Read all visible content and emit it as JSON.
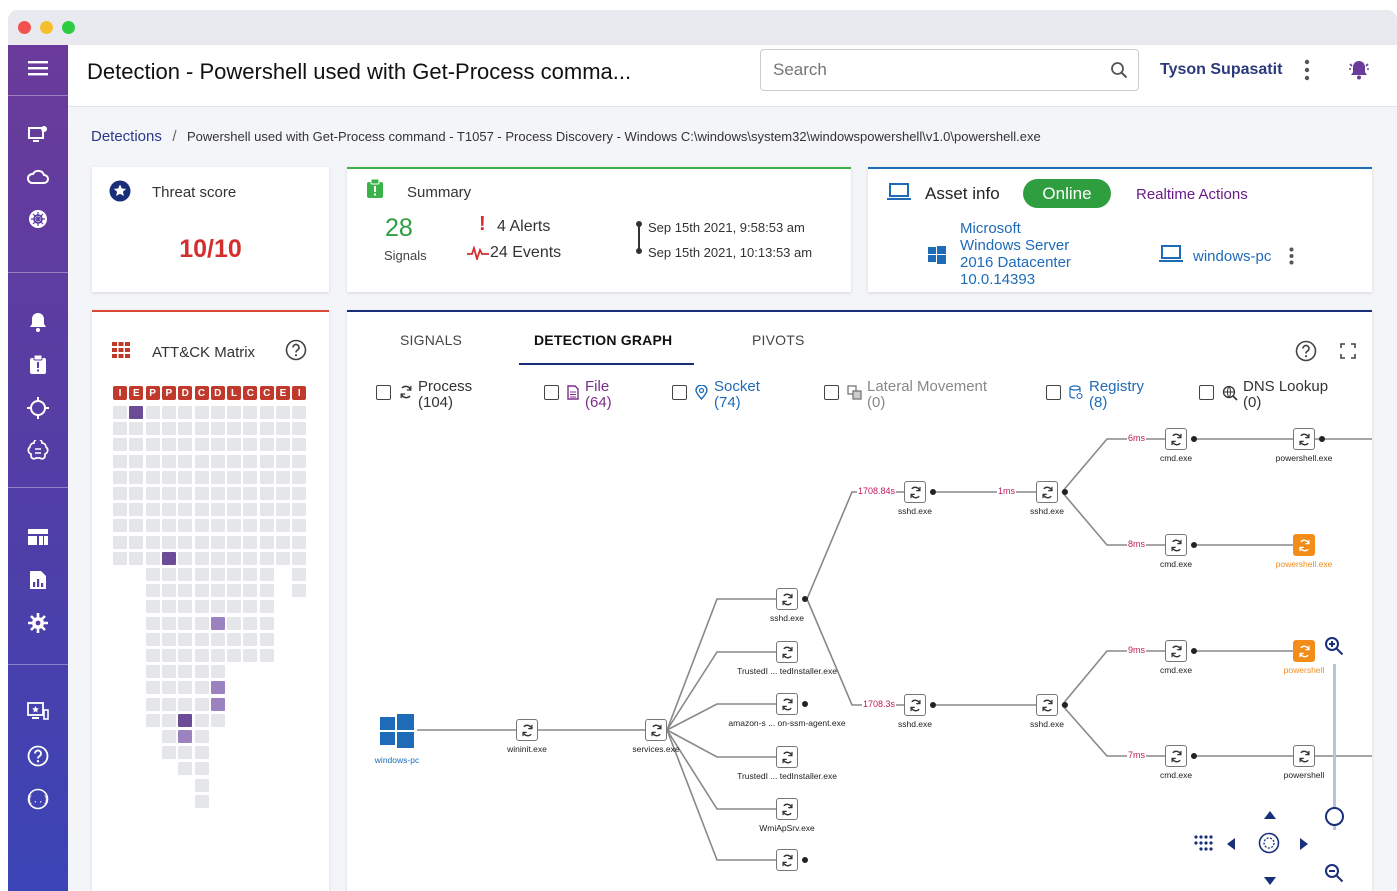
{
  "window": {
    "controls": [
      "close",
      "minimize",
      "maximize"
    ]
  },
  "header": {
    "title": "Detection - Powershell used with Get-Process comma...",
    "search_placeholder": "Search",
    "user": "Tyson Supasatit"
  },
  "breadcrumb": {
    "root": "Detections",
    "separator": "/",
    "current": "Powershell used with Get-Process command - T1057 - Process Discovery - Windows C:\\windows\\system32\\windowspowershell\\v1.0\\powershell.exe"
  },
  "threat": {
    "label": "Threat score",
    "value": "10/10"
  },
  "summary": {
    "label": "Summary",
    "signals_count": "28",
    "signals_label": "Signals",
    "alerts": "4 Alerts",
    "events": "24 Events",
    "time_start": "Sep 15th 2021, 9:58:53 am",
    "time_end": "Sep 15th 2021, 10:13:53 am"
  },
  "asset": {
    "label": "Asset info",
    "status": "Online",
    "realtime": "Realtime Actions",
    "os_line1": "Microsoft",
    "os_line2": "Windows Server",
    "os_line3": "2016 Datacenter",
    "os_version": "10.0.14393",
    "host": "windows-pc"
  },
  "matrix": {
    "label": "ATT&CK Matrix",
    "columns": [
      "I",
      "E",
      "P",
      "P",
      "D",
      "C",
      "D",
      "L",
      "C",
      "C",
      "E",
      "I"
    ],
    "column_heights": [
      13,
      13,
      20,
      22,
      23,
      25,
      20,
      16,
      16,
      16,
      14,
      12
    ],
    "selected_count": 4,
    "shaded_count": 5
  },
  "tabs": [
    {
      "label": "SIGNALS",
      "active": false
    },
    {
      "label": "DETECTION GRAPH",
      "active": true
    },
    {
      "label": "PIVOTS",
      "active": false
    }
  ],
  "filters": [
    {
      "label": "Process",
      "count": "(104)",
      "color": "#333333"
    },
    {
      "label": "File",
      "count": "(64)",
      "color": "#7b2d8b"
    },
    {
      "label": "Socket",
      "count": "(74)",
      "color": "#1e6bb8"
    },
    {
      "label": "Lateral Movement",
      "count": "(0)",
      "color": "#888888"
    },
    {
      "label": "Registry",
      "count": "(8)",
      "color": "#1e6bb8"
    },
    {
      "label": "DNS Lookup",
      "count": "(0)",
      "color": "#333333"
    }
  ],
  "graph": {
    "host_label": "windows-pc",
    "nodes": [
      "wininit.exe",
      "services.exe",
      "sshd.exe",
      "TrustedI ... tedInstaller.exe",
      "amazon-s ... on-ssm-agent.exe",
      "TrustedI ... tedInstaller.exe",
      "WmiApSrv.exe",
      "sshd.exe",
      "sshd.exe",
      "sshd.exe",
      "sshd.exe",
      "cmd.exe",
      "powershell.exe",
      "cmd.exe",
      "powershell.exe",
      "cmd.exe",
      "powershell",
      "cmd.exe",
      "powershell"
    ],
    "edge_labels": [
      "1708.84s",
      "1ms",
      "6ms",
      "8ms",
      "1708.3s",
      "9ms",
      "7ms"
    ]
  },
  "colors": {
    "accent_purple": "#6a3b9a",
    "threat_red": "#d32f2f",
    "online_green": "#2e9e3f",
    "highlight_orange": "#f28c1a",
    "link_blue": "#1e6bb8"
  }
}
